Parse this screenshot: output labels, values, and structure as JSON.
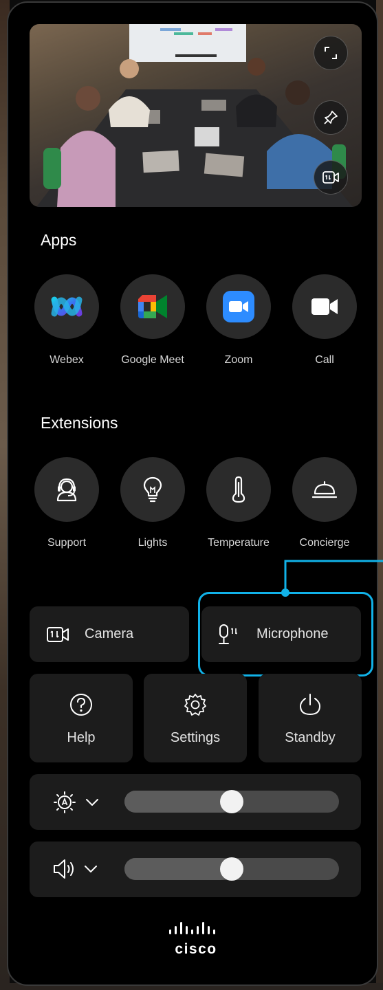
{
  "preview": {
    "fullscreen_icon": "expand-icon",
    "pin_icon": "pin-icon",
    "camera_switch_icon": "camera-switch-icon"
  },
  "apps": {
    "title": "Apps",
    "items": [
      {
        "label": "Webex",
        "icon": "webex-icon"
      },
      {
        "label": "Google Meet",
        "icon": "google-meet-icon"
      },
      {
        "label": "Zoom",
        "icon": "zoom-icon"
      },
      {
        "label": "Call",
        "icon": "call-video-icon"
      }
    ]
  },
  "extensions": {
    "title": "Extensions",
    "items": [
      {
        "label": "Support",
        "icon": "headset-icon"
      },
      {
        "label": "Lights",
        "icon": "lightbulb-icon"
      },
      {
        "label": "Temperature",
        "icon": "thermometer-icon"
      },
      {
        "label": "Concierge",
        "icon": "service-bell-icon"
      }
    ]
  },
  "controls": {
    "camera_label": "Camera",
    "microphone_label": "Microphone",
    "help_label": "Help",
    "settings_label": "Settings",
    "standby_label": "Standby"
  },
  "sliders": {
    "brightness_value": 0.5,
    "volume_value": 0.5
  },
  "colors": {
    "highlight": "#11b2e8",
    "tile": "#1c1c1c",
    "circle": "#2b2b2b",
    "zoom_blue": "#2d8cff"
  },
  "brand": {
    "wordmark": "cisco"
  }
}
